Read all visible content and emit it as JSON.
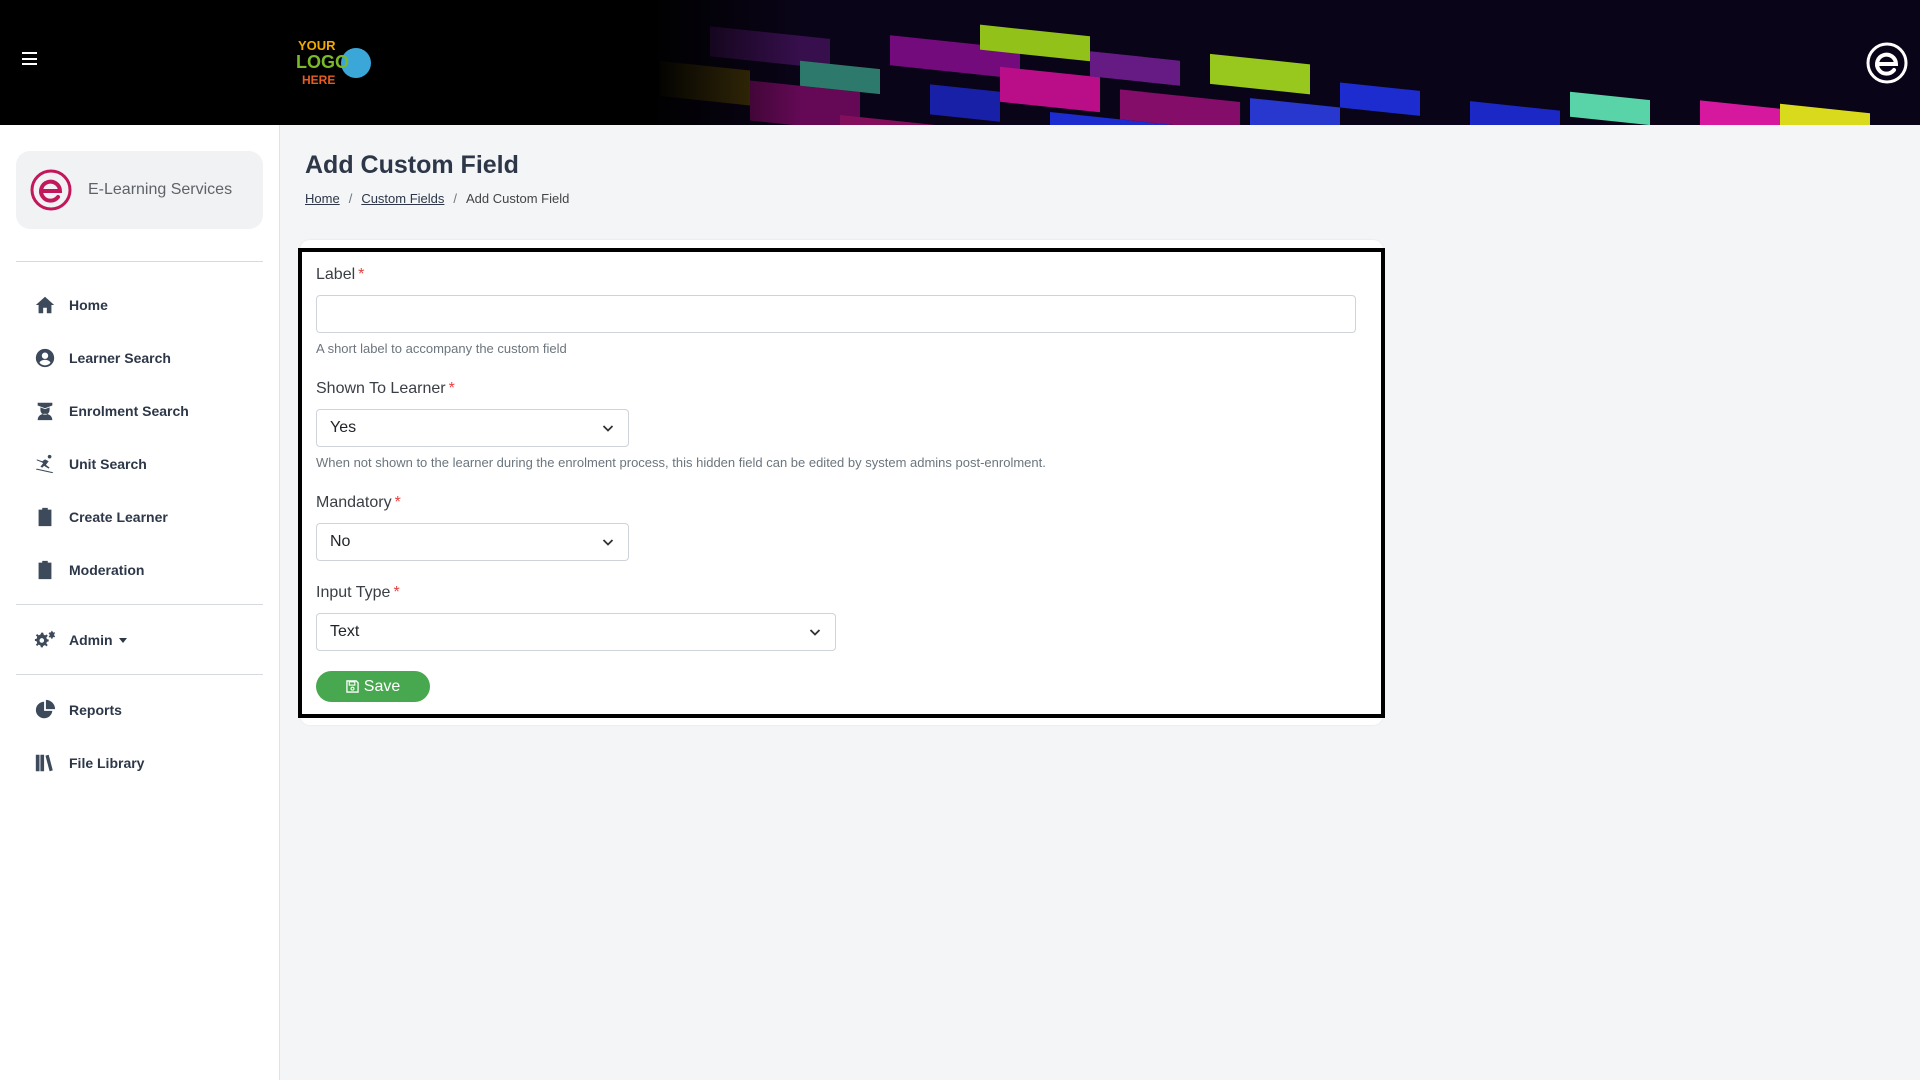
{
  "header": {
    "logo_text": [
      "YOUR",
      "LOGO",
      "HERE"
    ]
  },
  "sidebar": {
    "org_name": "E-Learning Services",
    "items": [
      {
        "label": "Home"
      },
      {
        "label": "Learner Search"
      },
      {
        "label": "Enrolment Search"
      },
      {
        "label": "Unit Search"
      },
      {
        "label": "Create Learner"
      },
      {
        "label": "Moderation"
      },
      {
        "label": "Admin"
      },
      {
        "label": "Reports"
      },
      {
        "label": "File Library"
      }
    ]
  },
  "main": {
    "title": "Add Custom Field",
    "breadcrumb": [
      "Home",
      "Custom Fields",
      "Add Custom Field"
    ],
    "form": {
      "label": {
        "label": "Label",
        "required": "*",
        "value": "",
        "placeholder": "",
        "help": "A short label to accompany the custom field"
      },
      "shown_to_learner": {
        "label": "Shown To Learner",
        "required": "*",
        "value": "Yes",
        "help": "When not shown to the learner during the enrolment process, this hidden field can be edited by system admins post-enrolment."
      },
      "mandatory": {
        "label": "Mandatory",
        "required": "*",
        "value": "No"
      },
      "input_type": {
        "label": "Input Type",
        "required": "*",
        "value": "Text"
      },
      "save_label": "Save"
    }
  },
  "colors": {
    "save_button": "#48a84f",
    "brand": "#c2185b",
    "required": "#e53e3e"
  }
}
